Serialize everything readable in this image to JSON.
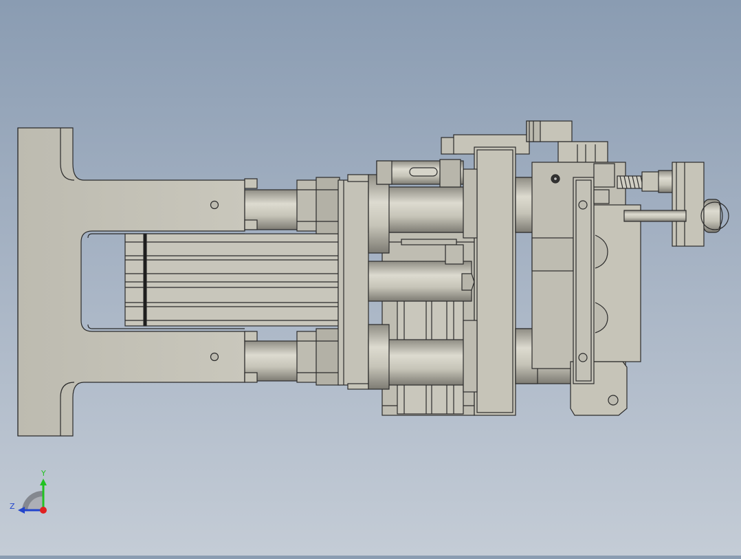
{
  "viewport": {
    "background_top": "#8a9cb2",
    "background_bottom": "#c4ccd6",
    "part_fill": "#c6c4b8",
    "part_fill_dark": "#a7a59a",
    "part_edge": "#2a2a2a"
  },
  "triad": {
    "y_label": "Y",
    "z_label": "Z",
    "y_color": "#22c222",
    "z_color": "#2244cc",
    "origin_color": "#e02020"
  }
}
